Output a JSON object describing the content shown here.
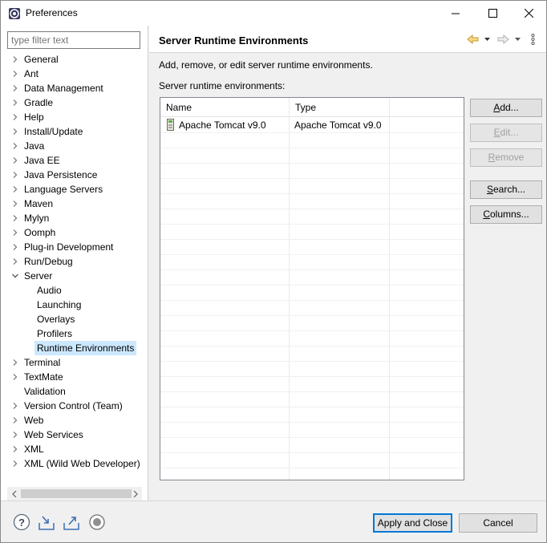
{
  "window": {
    "title": "Preferences"
  },
  "filter": {
    "placeholder": "type filter text"
  },
  "tree": [
    {
      "label": "General",
      "expandable": true
    },
    {
      "label": "Ant",
      "expandable": true
    },
    {
      "label": "Data Management",
      "expandable": true
    },
    {
      "label": "Gradle",
      "expandable": true
    },
    {
      "label": "Help",
      "expandable": true
    },
    {
      "label": "Install/Update",
      "expandable": true
    },
    {
      "label": "Java",
      "expandable": true
    },
    {
      "label": "Java EE",
      "expandable": true
    },
    {
      "label": "Java Persistence",
      "expandable": true
    },
    {
      "label": "Language Servers",
      "expandable": true
    },
    {
      "label": "Maven",
      "expandable": true
    },
    {
      "label": "Mylyn",
      "expandable": true
    },
    {
      "label": "Oomph",
      "expandable": true
    },
    {
      "label": "Plug-in Development",
      "expandable": true
    },
    {
      "label": "Run/Debug",
      "expandable": true
    },
    {
      "label": "Server",
      "expandable": true,
      "expanded": true
    },
    {
      "label": "Audio",
      "child": true
    },
    {
      "label": "Launching",
      "child": true
    },
    {
      "label": "Overlays",
      "child": true
    },
    {
      "label": "Profilers",
      "child": true
    },
    {
      "label": "Runtime Environments",
      "child": true,
      "selected": true
    },
    {
      "label": "Terminal",
      "expandable": true
    },
    {
      "label": "TextMate",
      "expandable": true
    },
    {
      "label": "Validation",
      "expandable": false
    },
    {
      "label": "Version Control (Team)",
      "expandable": true
    },
    {
      "label": "Web",
      "expandable": true
    },
    {
      "label": "Web Services",
      "expandable": true
    },
    {
      "label": "XML",
      "expandable": true
    },
    {
      "label": "XML (Wild Web Developer)",
      "expandable": true
    }
  ],
  "page": {
    "title": "Server Runtime Environments",
    "description": "Add, remove, or edit server runtime environments.",
    "list_label": "Server runtime environments:",
    "columns": [
      "Name",
      "Type"
    ],
    "rows": [
      {
        "name": "Apache Tomcat v9.0",
        "type": "Apache Tomcat v9.0"
      }
    ]
  },
  "buttons": {
    "add": "Add...",
    "edit": "Edit...",
    "remove": "Remove",
    "search": "Search...",
    "columns": "Columns..."
  },
  "footer": {
    "apply_close": "Apply and Close",
    "cancel": "Cancel"
  },
  "colors": {
    "accent": "#0078d7",
    "selection": "#cce8ff"
  }
}
